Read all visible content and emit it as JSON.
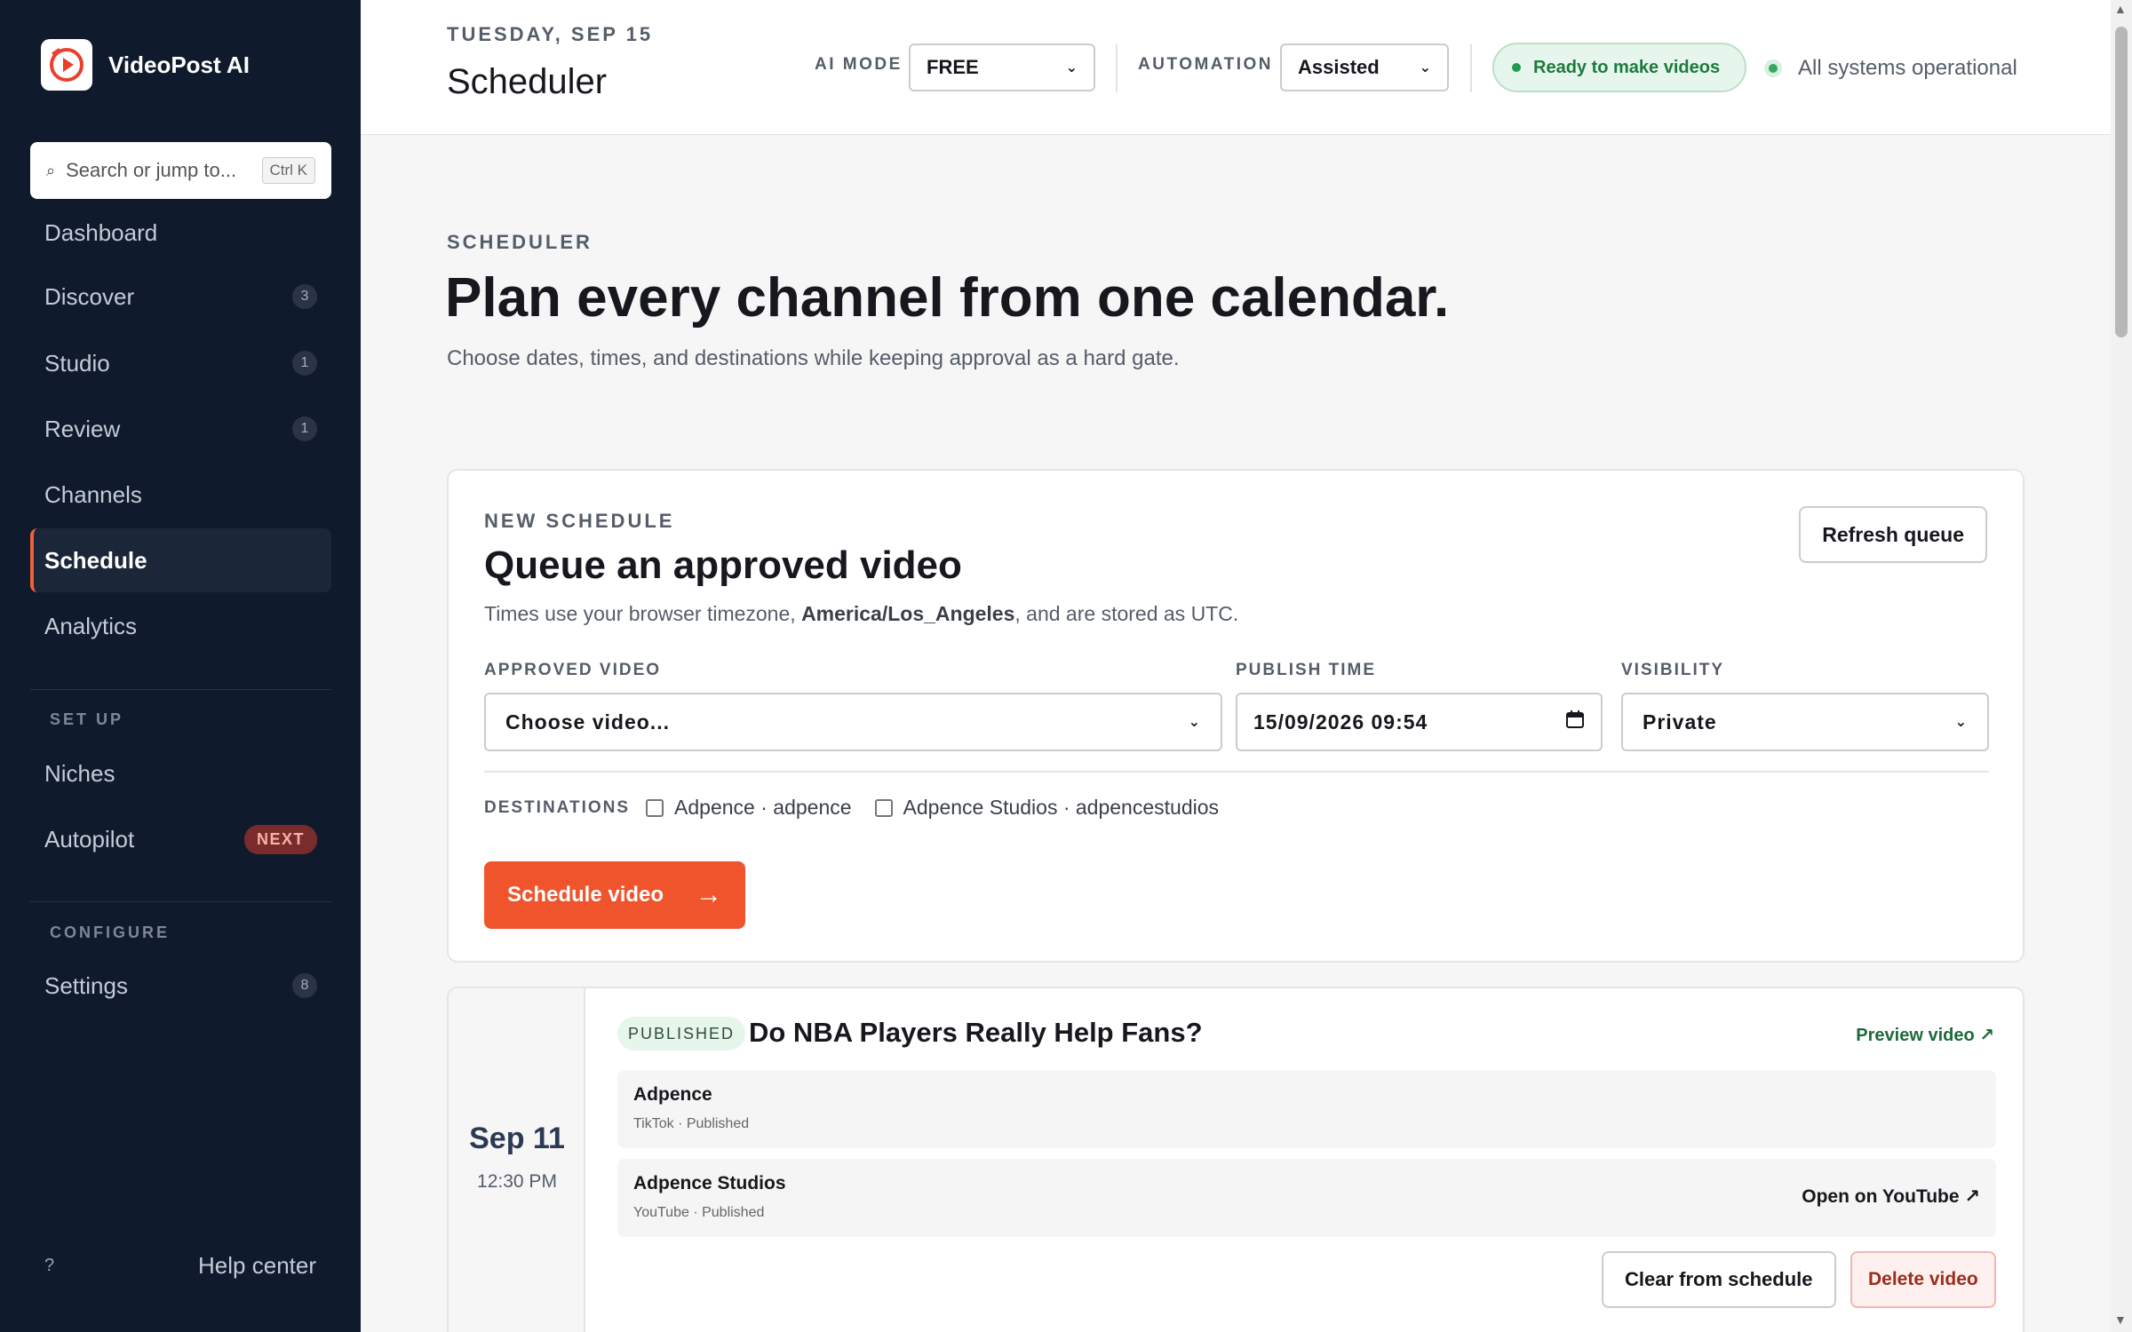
{
  "brand": {
    "name": "VideoPost AI"
  },
  "search": {
    "placeholder": "Search or jump to...",
    "shortcut": "Ctrl K"
  },
  "nav": {
    "primary": [
      {
        "label": "Dashboard",
        "badge": ""
      },
      {
        "label": "Discover",
        "badge": "3"
      },
      {
        "label": "Studio",
        "badge": "1"
      },
      {
        "label": "Review",
        "badge": "1"
      },
      {
        "label": "Channels",
        "badge": ""
      },
      {
        "label": "Schedule",
        "badge": "",
        "active": true
      },
      {
        "label": "Analytics",
        "badge": ""
      }
    ],
    "setup_label": "SET UP",
    "setup": [
      {
        "label": "Niches",
        "badge": ""
      },
      {
        "label": "Autopilot",
        "badge": "NEXT"
      }
    ],
    "configure_label": "CONFIGURE",
    "configure": [
      {
        "label": "Settings",
        "badge": "8"
      }
    ],
    "help_icon": "?",
    "help_label": "Help center"
  },
  "topbar": {
    "date": "TUESDAY, SEP 15",
    "title": "Scheduler",
    "ai_mode_label": "AI MODE",
    "ai_mode_value": "FREE",
    "automation_label": "AUTOMATION",
    "automation_value": "Assisted",
    "ready_status": "Ready to make videos",
    "system_status": "All systems operational"
  },
  "hero": {
    "eyebrow": "SCHEDULER",
    "title": "Plan every channel from one calendar.",
    "subtitle": "Choose dates, times, and destinations while keeping approval as a hard gate."
  },
  "new_schedule": {
    "eyebrow": "NEW SCHEDULE",
    "title": "Queue an approved video",
    "subtitle_before": "Times use your browser timezone, ",
    "timezone": "America/Los_Angeles",
    "subtitle_after": ", and are stored as UTC.",
    "refresh_label": "Refresh queue",
    "video_label": "APPROVED VIDEO",
    "video_value": "Choose video...",
    "time_label": "PUBLISH TIME",
    "time_value": "15/09/2026 09:54",
    "visibility_label": "VISIBILITY",
    "visibility_value": "Private",
    "destinations_label": "DESTINATIONS",
    "destinations": [
      {
        "label": "Adpence · adpence",
        "checked": false
      },
      {
        "label": "Adpence Studios · adpencestudios",
        "checked": false
      }
    ],
    "submit_label": "Schedule video",
    "submit_arrow": "→"
  },
  "scheduled": [
    {
      "day": "Sep 11",
      "time": "12:30 PM",
      "status": "PUBLISHED",
      "title": "Do NBA Players Really Help Fans?",
      "preview_label": "Preview video ↗",
      "destinations": [
        {
          "name": "Adpence",
          "meta": "TikTok · Published",
          "link": ""
        },
        {
          "name": "Adpence Studios",
          "meta": "YouTube · Published",
          "link": "Open on YouTube ↗"
        }
      ],
      "clear_label": "Clear from schedule",
      "delete_label": "Delete video"
    }
  ],
  "colors": {
    "sidebar_bg": "#0f1b2d",
    "accent": "#f0542d",
    "success": "#1d7a3e"
  }
}
